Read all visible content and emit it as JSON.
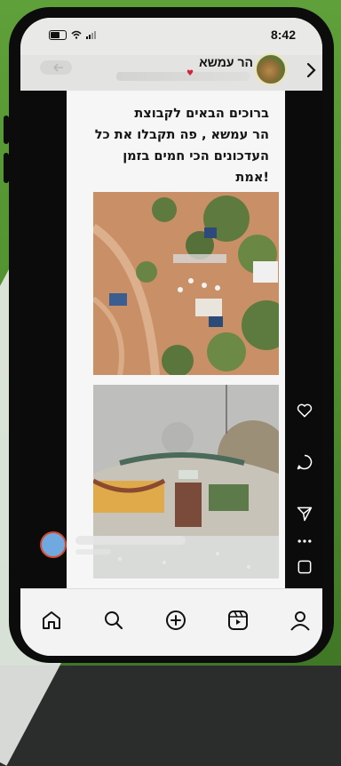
{
  "status_bar": {
    "time": "8:42"
  },
  "header": {
    "title": "הר עמשא"
  },
  "post": {
    "caption": "ברוכים הבאים לקבוצת\nהר עמשא , פה תקבלו את כל\nהעדכונים הכי חמים בזמן\n!אמת"
  },
  "icons": {
    "back": "arrow-left-icon",
    "next": "chevron-right-icon",
    "like": "heart-icon",
    "comment": "comment-icon",
    "share": "send-icon",
    "more": "more-dots-icon",
    "save": "bookmark-icon",
    "home": "home-icon",
    "search": "search-icon",
    "create": "plus-circle-icon",
    "reels": "reels-icon",
    "profile": "profile-icon"
  },
  "colors": {
    "background_green": "#5fa03a",
    "phone_frame": "#0c0c0c",
    "record_dot": "#6fa9e0",
    "record_ring": "#d64a2f"
  }
}
